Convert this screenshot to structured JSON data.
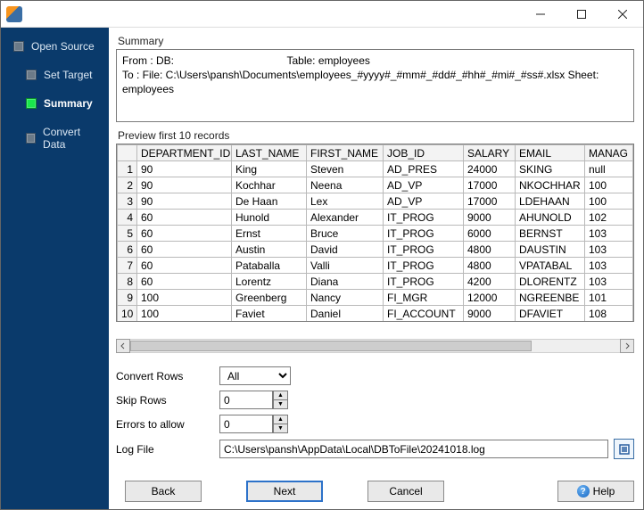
{
  "sidebar": {
    "items": [
      {
        "label": "Open Source"
      },
      {
        "label": "Set Target"
      },
      {
        "label": "Summary"
      },
      {
        "label": "Convert Data"
      }
    ],
    "active_index": 2
  },
  "summary": {
    "section_label": "Summary",
    "from_label": "From : DB:",
    "table_label": "Table: employees",
    "to_line": "To : File: C:\\Users\\pansh\\Documents\\employees_#yyyy#_#mm#_#dd#_#hh#_#mi#_#ss#.xlsx Sheet: employees"
  },
  "preview": {
    "label": "Preview first 10 records",
    "columns": [
      "DEPARTMENT_ID",
      "LAST_NAME",
      "FIRST_NAME",
      "JOB_ID",
      "SALARY",
      "EMAIL",
      "MANAG"
    ],
    "rows": [
      [
        "90",
        "King",
        "Steven",
        "AD_PRES",
        "24000",
        "SKING",
        "null"
      ],
      [
        "90",
        "Kochhar",
        "Neena",
        "AD_VP",
        "17000",
        "NKOCHHAR",
        "100"
      ],
      [
        "90",
        "De Haan",
        "Lex",
        "AD_VP",
        "17000",
        "LDEHAAN",
        "100"
      ],
      [
        "60",
        "Hunold",
        "Alexander",
        "IT_PROG",
        "9000",
        "AHUNOLD",
        "102"
      ],
      [
        "60",
        "Ernst",
        "Bruce",
        "IT_PROG",
        "6000",
        "BERNST",
        "103"
      ],
      [
        "60",
        "Austin",
        "David",
        "IT_PROG",
        "4800",
        "DAUSTIN",
        "103"
      ],
      [
        "60",
        "Pataballa",
        "Valli",
        "IT_PROG",
        "4800",
        "VPATABAL",
        "103"
      ],
      [
        "60",
        "Lorentz",
        "Diana",
        "IT_PROG",
        "4200",
        "DLORENTZ",
        "103"
      ],
      [
        "100",
        "Greenberg",
        "Nancy",
        "FI_MGR",
        "12000",
        "NGREENBE",
        "101"
      ],
      [
        "100",
        "Faviet",
        "Daniel",
        "FI_ACCOUNT",
        "9000",
        "DFAVIET",
        "108"
      ]
    ]
  },
  "form": {
    "convert_rows_label": "Convert Rows",
    "convert_rows_value": "All",
    "skip_rows_label": "Skip Rows",
    "skip_rows_value": "0",
    "errors_label": "Errors to allow",
    "errors_value": "0",
    "log_label": "Log File",
    "log_value": "C:\\Users\\pansh\\AppData\\Local\\DBToFile\\20241018.log"
  },
  "buttons": {
    "back": "Back",
    "next": "Next",
    "cancel": "Cancel",
    "help": "Help"
  }
}
